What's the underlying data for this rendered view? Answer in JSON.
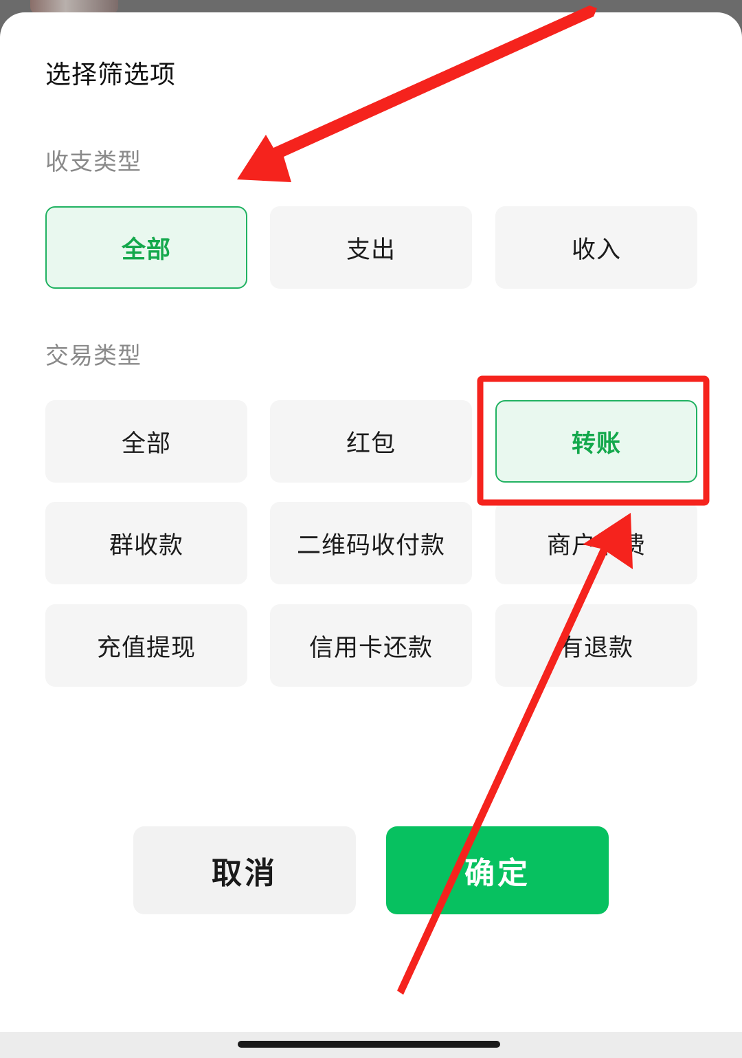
{
  "sheet": {
    "title": "选择筛选项"
  },
  "income_expense": {
    "section_label": "收支类型",
    "options": [
      {
        "label": "全部",
        "selected": true
      },
      {
        "label": "支出",
        "selected": false
      },
      {
        "label": "收入",
        "selected": false
      }
    ]
  },
  "transaction_type": {
    "section_label": "交易类型",
    "options": [
      {
        "label": "全部",
        "selected": false
      },
      {
        "label": "红包",
        "selected": false
      },
      {
        "label": "转账",
        "selected": true
      },
      {
        "label": "群收款",
        "selected": false
      },
      {
        "label": "二维码收付款",
        "selected": false
      },
      {
        "label": "商户消费",
        "selected": false
      },
      {
        "label": "充值提现",
        "selected": false
      },
      {
        "label": "信用卡还款",
        "selected": false
      },
      {
        "label": "有退款",
        "selected": false
      }
    ]
  },
  "actions": {
    "cancel_label": "取消",
    "confirm_label": "确定"
  },
  "colors": {
    "accent_green": "#07c160",
    "selected_bg": "#e9f8ef",
    "annotation_red": "#f5231d"
  },
  "annotations": {
    "arrow_count": 2,
    "highlight_box_target": "转账"
  }
}
